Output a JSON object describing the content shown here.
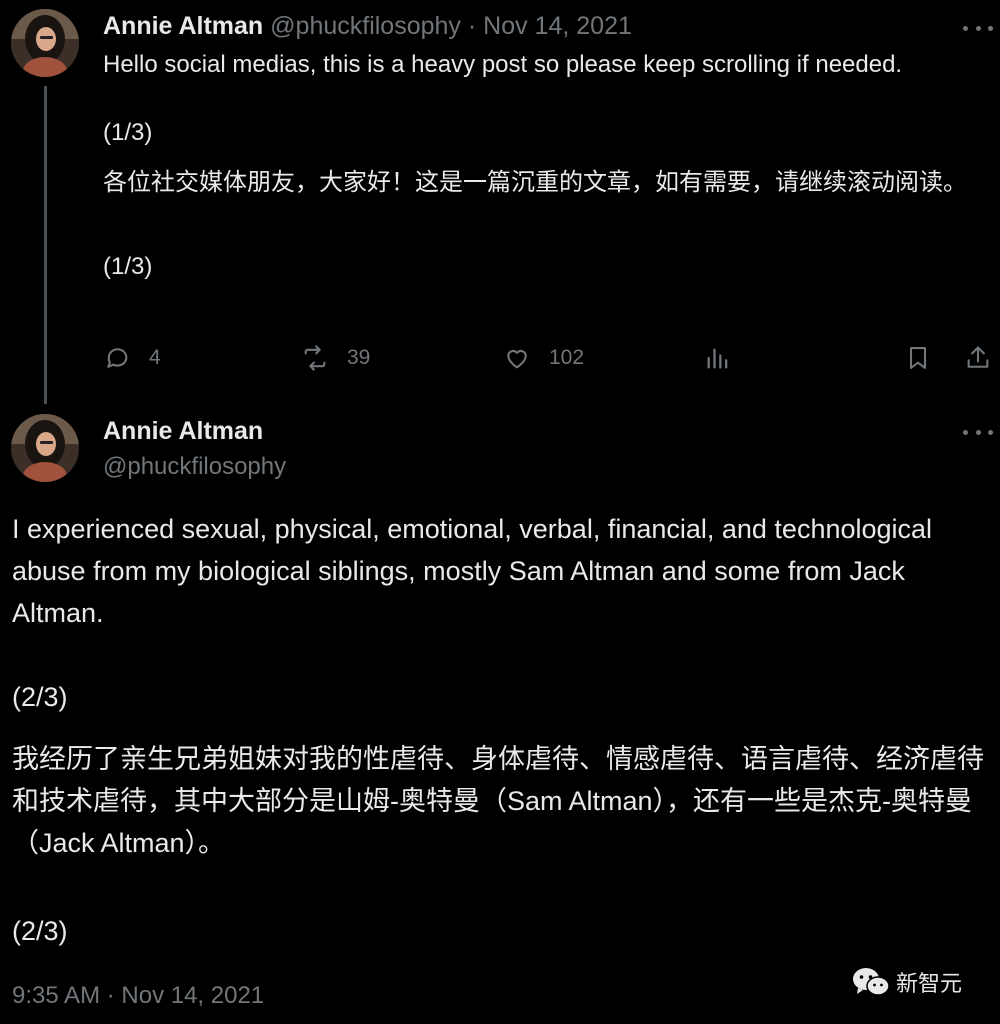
{
  "tweet1": {
    "author_name": "Annie Altman",
    "handle": "@phuckfilosophy",
    "separator": "·",
    "date": "Nov 14, 2021",
    "paragraphs": [
      "Hello social medias, this is a heavy post so please keep scrolling if needed.",
      "(1/3)",
      "各位社交媒体朋友，大家好！这是一篇沉重的文章，如有需要，请继续滚动阅读。",
      "(1/3)"
    ],
    "actions": {
      "reply_count": "4",
      "retweet_count": "39",
      "like_count": "102"
    }
  },
  "tweet2": {
    "author_name": "Annie Altman",
    "handle": "@phuckfilosophy",
    "paragraphs": [
      "I experienced sexual, physical, emotional, verbal, financial, and technological abuse from my biological siblings, mostly Sam Altman and some from Jack Altman.",
      "(2/3)",
      "我经历了亲生兄弟姐妹对我的性虐待、身体虐待、情感虐待、语言虐待、经济虐待和技术虐待，其中大部分是山姆-奥特曼（Sam Altman），还有一些是杰克-奥特曼（Jack Altman）。",
      "(2/3)"
    ],
    "timestamp": "9:35 AM · Nov 14, 2021"
  },
  "watermark": {
    "text": "新智元",
    "icon": "wechat-icon"
  },
  "icons": {
    "reply": "reply-icon",
    "retweet": "retweet-icon",
    "like": "heart-icon",
    "views": "views-icon",
    "bookmark": "bookmark-icon",
    "share": "share-icon",
    "more": "more-icon"
  },
  "colors": {
    "background": "#000000",
    "text_primary": "#e7e9ea",
    "text_secondary": "#71767b",
    "thread_line": "#4a4f55"
  }
}
